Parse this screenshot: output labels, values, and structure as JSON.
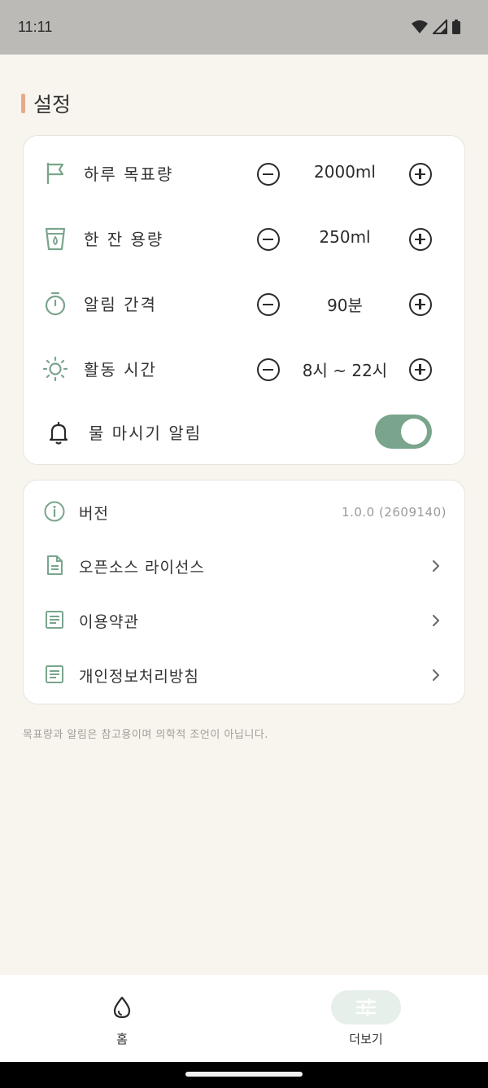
{
  "status_bar": {
    "time": "11:11"
  },
  "section": {
    "title": "설정"
  },
  "settings": {
    "daily_goal": {
      "label": "하루 목표량",
      "value": "2000ml"
    },
    "cup_size": {
      "label": "한 잔 용량",
      "value": "250ml"
    },
    "reminder_interval": {
      "label": "알림 간격",
      "value": "90분"
    },
    "active_hours": {
      "label": "활동 시간",
      "value": "8시 ~ 22시"
    },
    "drink_reminder": {
      "label": "물 마시기 알림",
      "enabled": true
    }
  },
  "info": {
    "version": {
      "label": "버전",
      "value": "1.0.0 (2609140)"
    },
    "licenses": {
      "label": "오픈소스 라이선스"
    },
    "terms": {
      "label": "이용약관"
    },
    "privacy": {
      "label": "개인정보처리방침"
    }
  },
  "disclaimer": "목표량과 알림은 참고용이며 의학적 조언이 아닙니다.",
  "nav": {
    "home": {
      "label": "홈",
      "icon": "water-drop-icon"
    },
    "more": {
      "label": "더보기",
      "icon": "sliders-icon",
      "selected": true
    }
  },
  "colors": {
    "accent": "#7aa58c",
    "title_accent": "#e8a98a",
    "background": "#f8f5ee"
  }
}
